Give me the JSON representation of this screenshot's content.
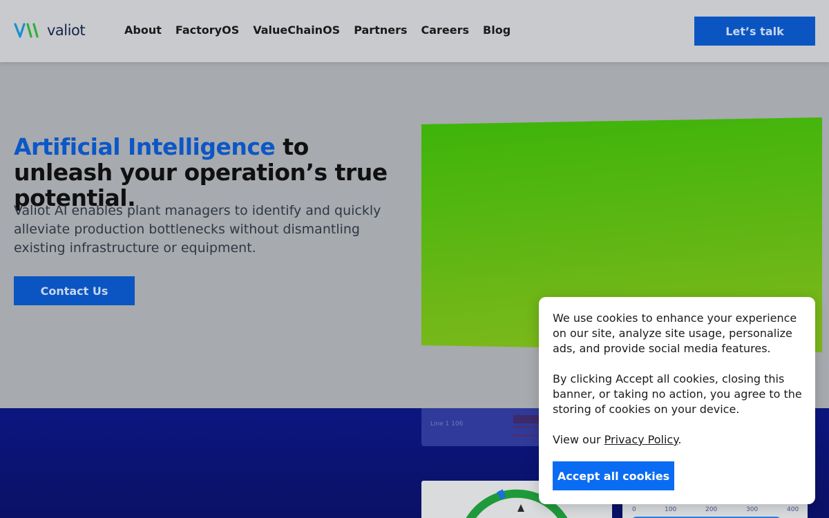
{
  "header": {
    "logo_text": "valiot",
    "nav": [
      "About",
      "FactoryOS",
      "ValueChainOS",
      "Partners",
      "Careers",
      "Blog"
    ],
    "cta_label": "Let’s talk"
  },
  "hero": {
    "headline_accent": "Artificial Intelligence",
    "headline_rest": " to unleash your operation’s true potential.",
    "subtext": "Valiot AI enables plant managers to identify and quickly alleviate production bottlenecks without dismantling existing infrastructure or equipment.",
    "cta_label": "Contact Us"
  },
  "dashboard_preview": {
    "line_label": "Line 1 106",
    "axis_ticks": [
      "0",
      "100",
      "200",
      "300",
      "400"
    ]
  },
  "cookie_banner": {
    "paragraph_1": "We use cookies to enhance your experience on our site, analyze site usage, personalize ads, and provide social media features.",
    "paragraph_2": "By clicking Accept all cookies, closing this banner, or taking no action, you agree to the storing of cookies on your device.",
    "view_prefix": "View our ",
    "privacy_link": "Privacy Policy",
    "view_suffix": ".",
    "accept_label": "Accept all cookies"
  },
  "colors": {
    "brand_blue": "#0b55c2",
    "accept_blue": "#0a6cf2",
    "accent_text": "#0b57c7",
    "hero_green": "#3db30a",
    "band_navy": "#0c1680"
  }
}
